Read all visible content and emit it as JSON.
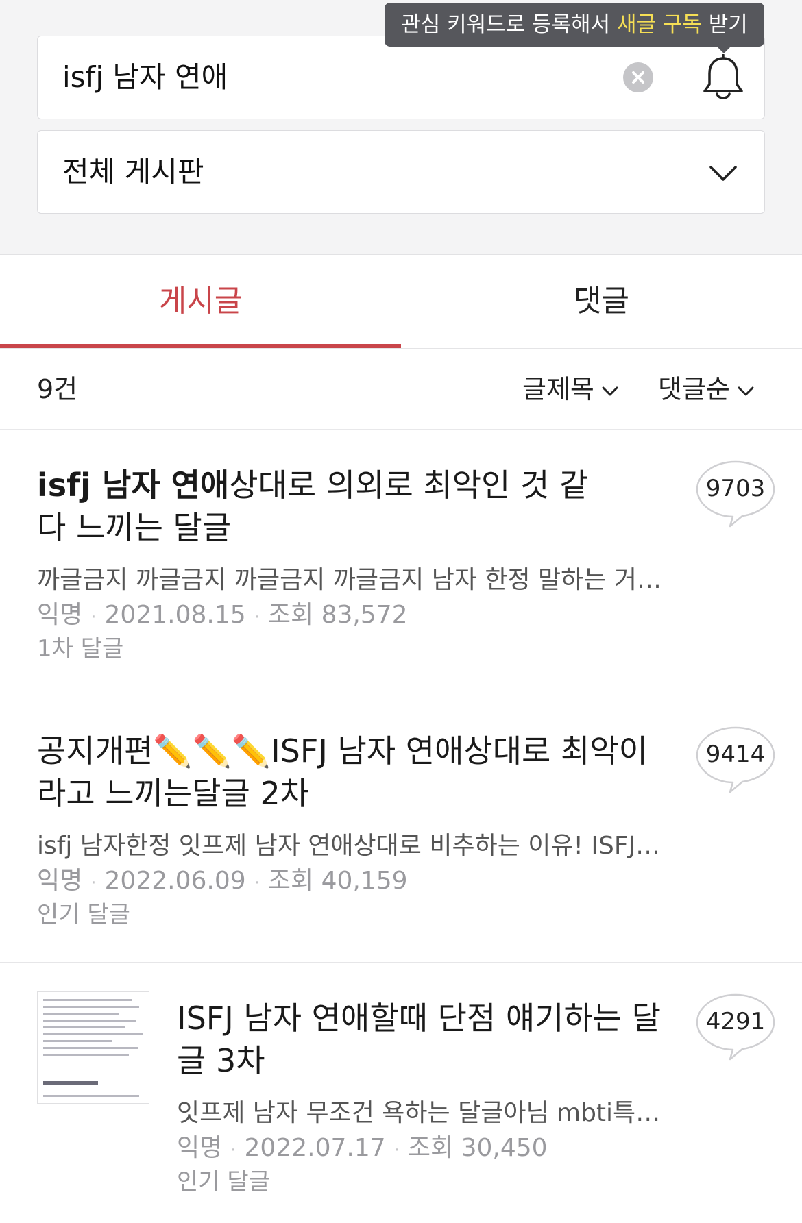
{
  "search": {
    "query": "isfj 남자 연애",
    "tooltip_before": "관심 키워드로 등록해서 ",
    "tooltip_highlight": "새글 구독",
    "tooltip_after": " 받기"
  },
  "board": {
    "selected": "전체 게시판"
  },
  "tabs": [
    {
      "label": "게시글",
      "active": true
    },
    {
      "label": "댓글",
      "active": false
    }
  ],
  "results": {
    "count": "9건",
    "filters": [
      "글제목",
      "댓글순"
    ]
  },
  "posts": [
    {
      "title_highlight": "isfj 남자 연애",
      "title_rest": "상대로 의외로 최악인 것 같다 느끼는 달글",
      "snippet": "까글금지 까글금지 까글금지 까글금지 남자 한정 말하는 거 아니고 isfj 연애상대로 최악인 이유",
      "author": "익명",
      "date": "2021.08.15",
      "views": "조회 83,572",
      "tag": "1차 달글",
      "comments": "9703"
    },
    {
      "title_highlight": "",
      "title_rest": "공지개편✏️✏️✏️ISFJ 남자 연애상대로 최악이라고 느끼는달글 2차",
      "snippet": "isfj 남자한정 잇프제 남자 연애상대로 비추하는 이유! ISFJ 남자 연애상대로 최악",
      "author": "익명",
      "date": "2022.06.09",
      "views": "조회 40,159",
      "tag": "인기 달글",
      "comments": "9414"
    },
    {
      "title_highlight": "",
      "title_rest": "ISFJ 남자 연애할때 단점 얘기하는 달글 3차",
      "snippet": "잇프제 남자 무조건 욕하는 달글아님 mbti특징 얘기하는 달글",
      "author": "익명",
      "date": "2022.07.17",
      "views": "조회 30,450",
      "tag": "인기 달글",
      "comments": "4291",
      "thumbnail_caption": "4-1 지 혼자 손절 장항"
    }
  ],
  "colors": {
    "accent": "#c9454a",
    "tooltip_bg": "#56575c",
    "tooltip_highlight": "#f6df55"
  }
}
